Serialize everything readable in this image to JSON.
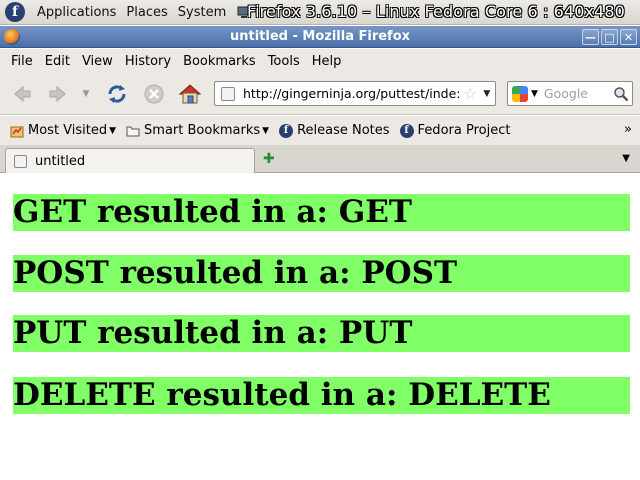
{
  "panel": {
    "menus": [
      "Applications",
      "Places",
      "System"
    ],
    "overlay_title": "Firefox 3.6.10 – Linux Fedora Core 6 : 640x480"
  },
  "window": {
    "title": "untitled - Mozilla Firefox"
  },
  "menubar": {
    "items": [
      "File",
      "Edit",
      "View",
      "History",
      "Bookmarks",
      "Tools",
      "Help"
    ]
  },
  "navbar": {
    "url": "http://gingerninja.org/puttest/inde:",
    "search_placeholder": "Google"
  },
  "bookmarks": {
    "items": [
      "Most Visited",
      "Smart Bookmarks",
      "Release Notes",
      "Fedora Project"
    ]
  },
  "tabs": {
    "items": [
      {
        "label": "untitled"
      }
    ]
  },
  "content": {
    "results": [
      "GET resulted in a: GET",
      "POST resulted in a: POST",
      "PUT resulted in a: PUT",
      "DELETE resulted in a: DELETE"
    ],
    "highlight_color": "#80ff67"
  }
}
